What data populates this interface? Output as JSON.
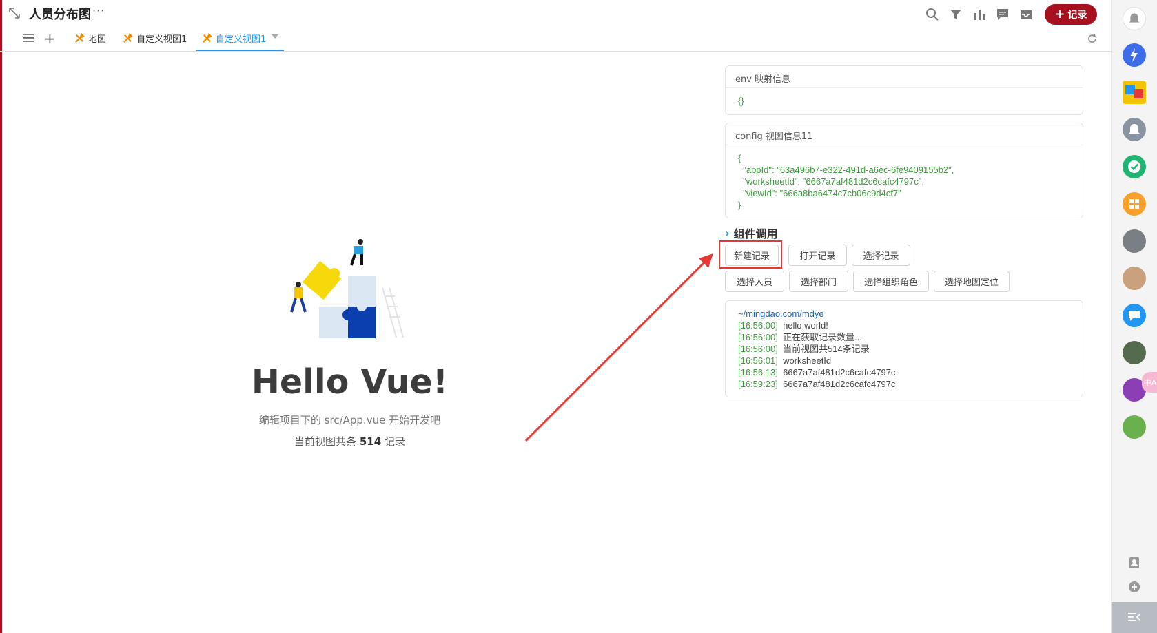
{
  "header": {
    "title": "人员分布图",
    "more": "···",
    "add_record_label": "记录",
    "add_record_plus": "+"
  },
  "tabs": [
    {
      "label": "地图"
    },
    {
      "label": "自定义视图1"
    },
    {
      "label": "自定义视图1",
      "active": true
    }
  ],
  "tabs_add": "+",
  "main": {
    "hello": "Hello Vue!",
    "hint": "编辑项目下的 src/App.vue 开始开发吧",
    "count_prefix": "当前视图共条",
    "count_value": "514",
    "count_suffix": "记录"
  },
  "env_panel": {
    "title": "env 映射信息",
    "body": "{}"
  },
  "config_panel": {
    "title": "config 视图信息11",
    "body": "{\n  \"appId\": \"63a496b7-e322-491d-a6ec-6fe9409155b2\",\n  \"worksheetId\": \"6667a7af481d2c6cafc4797c\",\n  \"viewId\": \"666a8ba6474c7cb06c9d4cf7\"\n}"
  },
  "components": {
    "title": "组件调用",
    "chevron": "›",
    "buttons_row1": [
      "新建记录",
      "打开记录",
      "选择记录"
    ],
    "buttons_row2": [
      "选择人员",
      "选择部门",
      "选择组织角色",
      "选择地图定位"
    ]
  },
  "log": {
    "url": "~/mingdao.com/mdye",
    "lines": [
      {
        "ts": "[16:56:00]",
        "msg": "hello world!"
      },
      {
        "ts": "[16:56:00]",
        "msg": "正在获取记录数量..."
      },
      {
        "ts": "[16:56:00]",
        "msg": "当前视图共514条记录"
      },
      {
        "ts": "[16:56:01]",
        "msg": "worksheetId"
      },
      {
        "ts": "[16:56:13]",
        "msg": "6667a7af481d2c6cafc4797c"
      },
      {
        "ts": "[16:59:23]",
        "msg": "6667a7af481d2c6cafc4797c"
      }
    ]
  },
  "sidebar": {
    "badge": "中A"
  },
  "colors": {
    "brand": "#a6101f",
    "accent": "#2196f3",
    "annotation": "#e53935"
  }
}
